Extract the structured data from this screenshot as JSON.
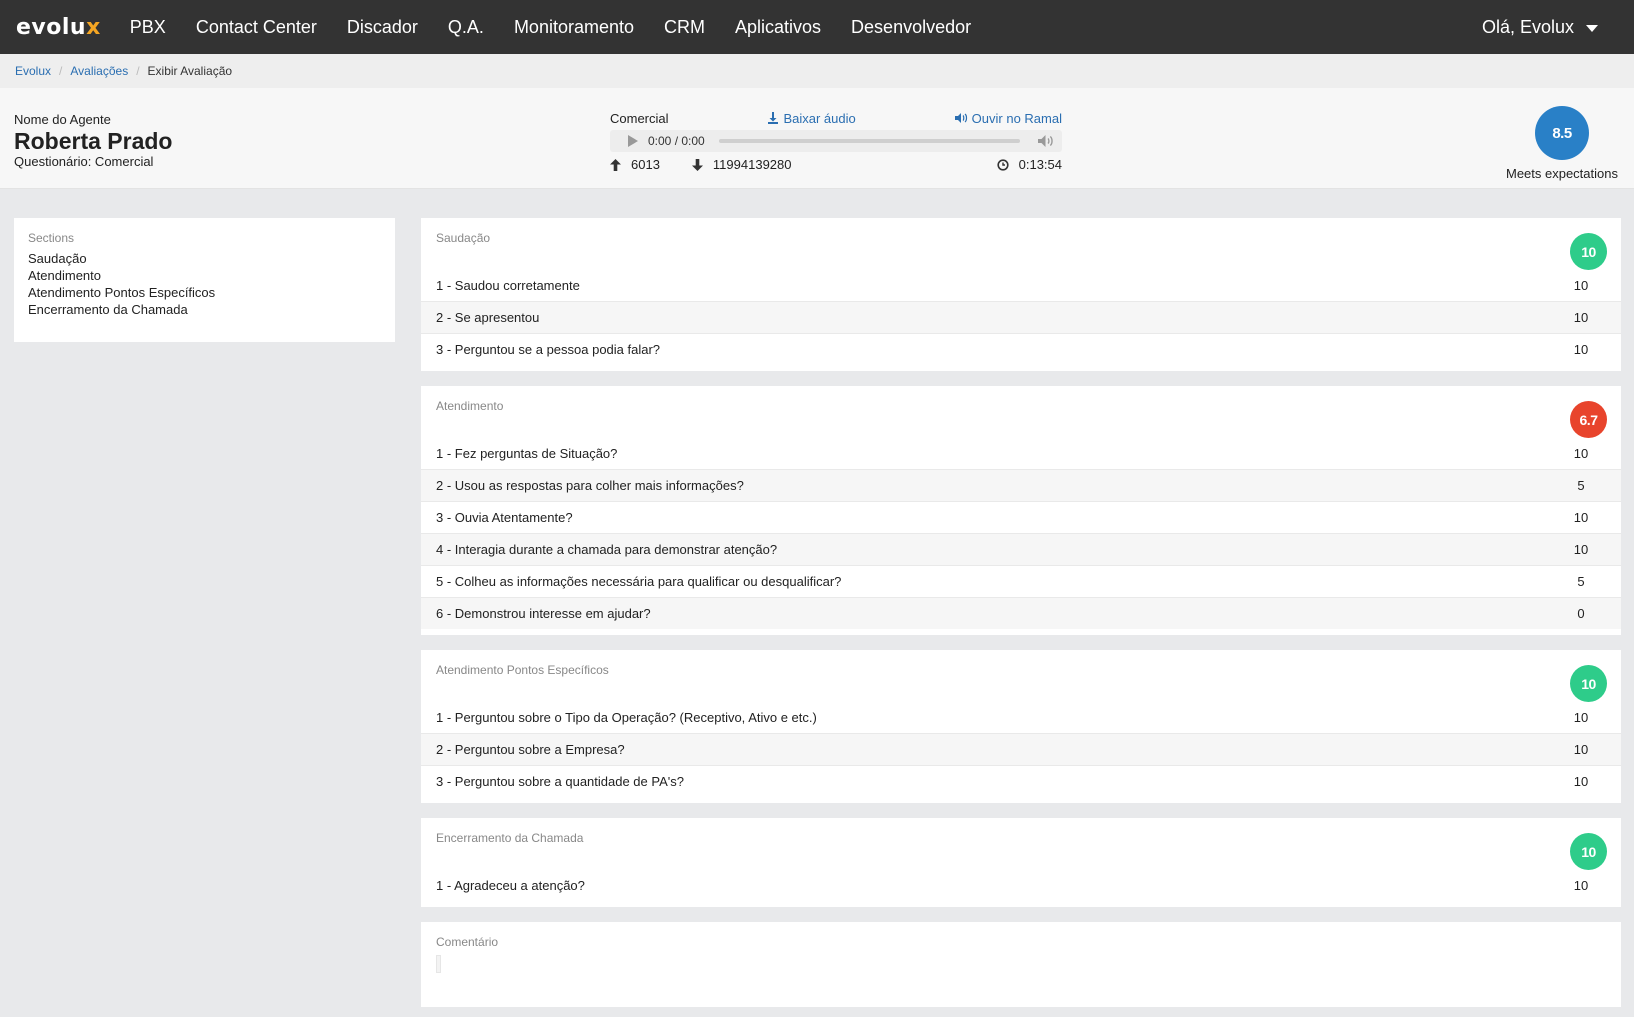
{
  "nav": {
    "logo_main": "evolu",
    "logo_accent": "x",
    "items": [
      "PBX",
      "Contact Center",
      "Discador",
      "Q.A.",
      "Monitoramento",
      "CRM",
      "Aplicativos",
      "Desenvolvedor"
    ],
    "user": "Olá, Evolux"
  },
  "breadcrumb": {
    "items": [
      "Evolux",
      "Avaliações"
    ],
    "current": "Exibir Avaliação"
  },
  "agent": {
    "label": "Nome do Agente",
    "name": "Roberta Prado",
    "questionnaire": "Questionário: Comercial"
  },
  "audio": {
    "queue": "Comercial",
    "download_label": "Baixar áudio",
    "listen_label": "Ouvir no Ramal",
    "time": "0:00 / 0:00",
    "progress": 0,
    "origin": "6013",
    "destination": "11994139280",
    "duration": "0:13:54"
  },
  "overall": {
    "score": "8.5",
    "label": "Meets expectations",
    "color": "#2980c7"
  },
  "sidebar": {
    "title": "Sections",
    "items": [
      "Saudação",
      "Atendimento",
      "Atendimento Pontos Específicos",
      "Encerramento da Chamada"
    ]
  },
  "sections": [
    {
      "title": "Saudação",
      "score": "10",
      "status": "green",
      "questions": [
        {
          "text": "1 - Saudou corretamente",
          "score": "10"
        },
        {
          "text": "2 - Se apresentou",
          "score": "10"
        },
        {
          "text": "3 - Perguntou se a pessoa podia falar?",
          "score": "10"
        }
      ]
    },
    {
      "title": "Atendimento",
      "score": "6.7",
      "status": "red",
      "questions": [
        {
          "text": "1 - Fez perguntas de Situação?",
          "score": "10"
        },
        {
          "text": "2 - Usou as respostas para colher mais informações?",
          "score": "5"
        },
        {
          "text": "3 - Ouvia Atentamente?",
          "score": "10"
        },
        {
          "text": "4 - Interagia durante a chamada para demonstrar atenção?",
          "score": "10"
        },
        {
          "text": "5 - Colheu as informações necessária para qualificar ou desqualificar?",
          "score": "5"
        },
        {
          "text": "6 - Demonstrou interesse em ajudar?",
          "score": "0"
        }
      ]
    },
    {
      "title": "Atendimento Pontos Específicos",
      "score": "10",
      "status": "green",
      "questions": [
        {
          "text": "1 - Perguntou sobre o Tipo da Operação? (Receptivo, Ativo e etc.)",
          "score": "10"
        },
        {
          "text": "2 - Perguntou sobre a Empresa?",
          "score": "10"
        },
        {
          "text": "3 - Perguntou sobre a quantidade de PA's?",
          "score": "10"
        }
      ]
    },
    {
      "title": "Encerramento da Chamada",
      "score": "10",
      "status": "green",
      "questions": [
        {
          "text": "1 - Agradeceu a atenção?",
          "score": "10"
        }
      ]
    }
  ],
  "comment": {
    "title": "Comentário"
  },
  "colors": {
    "nav_bg": "#333333",
    "accent": "#f5a623",
    "link": "#2a6eb1",
    "green": "#2ecc8a",
    "red": "#e8442c"
  }
}
